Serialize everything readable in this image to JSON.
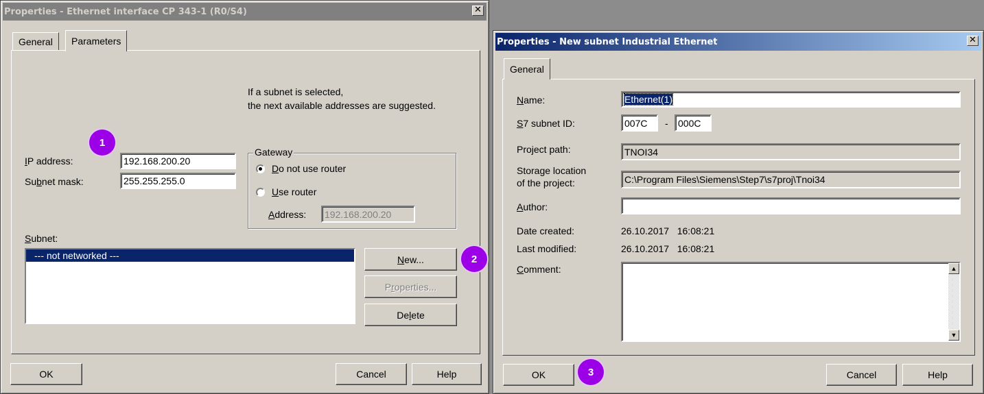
{
  "left_dialog": {
    "title": "Properties - Ethernet interface  CP 343-1 (R0/S4)",
    "tabs": [
      "General",
      "Parameters"
    ],
    "hint_line1": "If a subnet is selected,",
    "hint_line2": "the next available addresses are suggested.",
    "ip_label": "IP address:",
    "ip_value": "192.168.200.20",
    "mask_label": "Subnet mask:",
    "mask_value": "255.255.255.0",
    "gateway_title": "Gateway",
    "radio_no_router": "Do not use router",
    "radio_use_router": "Use router",
    "address_label": "Address:",
    "address_value": "192.168.200.20",
    "subnet_label": "Subnet:",
    "subnet_selected": "--- not networked ---",
    "btn_new": "New...",
    "btn_properties": "Properties...",
    "btn_delete": "Delete",
    "btn_ok": "OK",
    "btn_cancel": "Cancel",
    "btn_help": "Help"
  },
  "right_dialog": {
    "title": "Properties - New subnet Industrial Ethernet",
    "tab": "General",
    "name_label": "Name:",
    "name_value": "Ethernet(1)",
    "s7id_label": "S7 subnet ID:",
    "s7id_part1": "007C",
    "s7id_sep": "-",
    "s7id_part2": "000C",
    "project_path_label": "Project path:",
    "project_path_value": "TNOI34",
    "storage_label1": "Storage location",
    "storage_label2": "of the project:",
    "storage_value": "C:\\Program Files\\Siemens\\Step7\\s7proj\\Tnoi34",
    "author_label": "Author:",
    "author_value": "",
    "created_label": "Date created:",
    "created_value": "26.10.2017   16:08:21",
    "modified_label": "Last modified:",
    "modified_value": "26.10.2017   16:08:21",
    "comment_label": "Comment:",
    "comment_value": "",
    "btn_ok": "OK",
    "btn_cancel": "Cancel",
    "btn_help": "Help"
  },
  "badges": [
    "1",
    "2",
    "3"
  ],
  "colors": {
    "badge": "#9b00e6",
    "selection": "#0a246a",
    "dialog_bg": "#d4d0c8"
  }
}
